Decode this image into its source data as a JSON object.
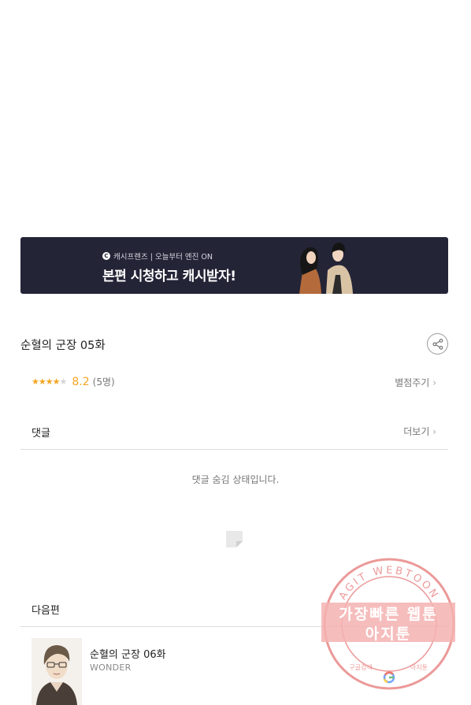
{
  "banner": {
    "logo_letter": "C",
    "subtitle": "캐시프렌즈 | 오늘부터 엔진 ON",
    "headline": "본편 시청하고 캐시받자!",
    "bg_color": "#242437"
  },
  "episode": {
    "title": "순혈의 군장 05화",
    "share_icon": "share-icon"
  },
  "rating": {
    "filled_stars": 4,
    "total_stars": 5,
    "score": "8.2",
    "count": "(5명)",
    "rate_link": "별점주기",
    "accent_color": "#f5a623"
  },
  "comments": {
    "label": "댓글",
    "more_link": "더보기",
    "hidden_message": "댓글 숨김 상태입니다."
  },
  "next": {
    "label": "다음편",
    "title": "순혈의 군장 06화",
    "author": "WONDER"
  },
  "watermark": {
    "arc_text": "AGIT WEBTOON",
    "line1": "가장빠른 웹툰",
    "line2": "아지툰",
    "bottom_left": "구글검색",
    "bottom_right": "아지툰",
    "color": "#e57373"
  }
}
